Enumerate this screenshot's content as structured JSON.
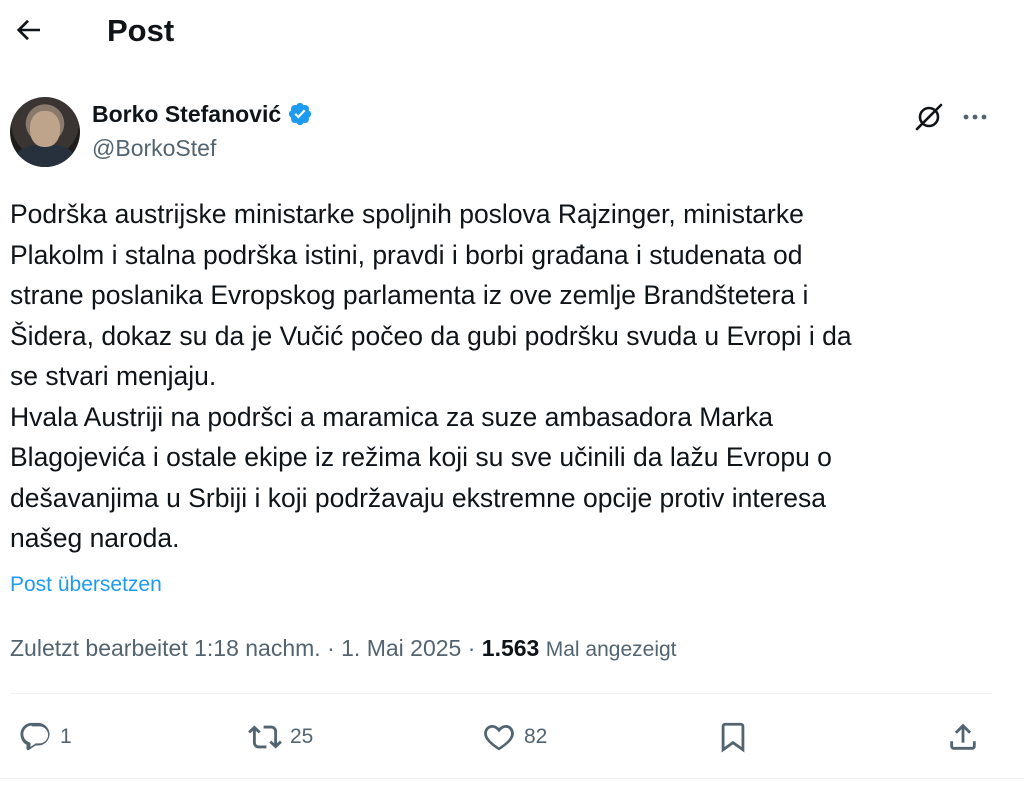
{
  "header": {
    "title": "Post"
  },
  "author": {
    "name": "Borko Stefanović",
    "handle": "@BorkoStef",
    "verified": true
  },
  "post": {
    "text": "Podrška austrijske ministarke spoljnih poslova Rajzinger, ministarke\nPlakolm i stalna podrška istini, pravdi i borbi građana i studenata od\nstrane poslanika Evropskog parlamenta iz ove zemlje Brandštetera i\nŠidera, dokaz su da je Vučić počeo da gubi podršku svuda u Evropi i da\nse stvari menjaju.\nHvala Austriji na podršci a maramica za suze ambasadora Marka\nBlagojevića i ostale ekipe iz režima koji su sve učinili da lažu Evropu o\ndešavanjima u Srbiji i koji podržavaju ekstremne opcije protiv interesa\nnašeg naroda.",
    "translate_label": "Post übersetzen",
    "edited_label": "Zuletzt bearbeitet 1:18 nachm.",
    "separator": " · ",
    "date": "1. Mai 2025",
    "views_count": "1.563",
    "views_label": "Mal angezeigt"
  },
  "actions": {
    "replies": "1",
    "reposts": "25",
    "likes": "82"
  },
  "icons": {
    "back": "arrow-left-icon",
    "verified": "verified-badge-icon",
    "grok": "grok-icon",
    "more": "more-dots-icon",
    "reply": "reply-bubble-icon",
    "repost": "repost-icon",
    "like": "heart-icon",
    "bookmark": "bookmark-icon",
    "share": "share-icon"
  },
  "colors": {
    "accent": "#1d9bf0",
    "secondary_text": "#536471",
    "primary_text": "#0f1419"
  }
}
